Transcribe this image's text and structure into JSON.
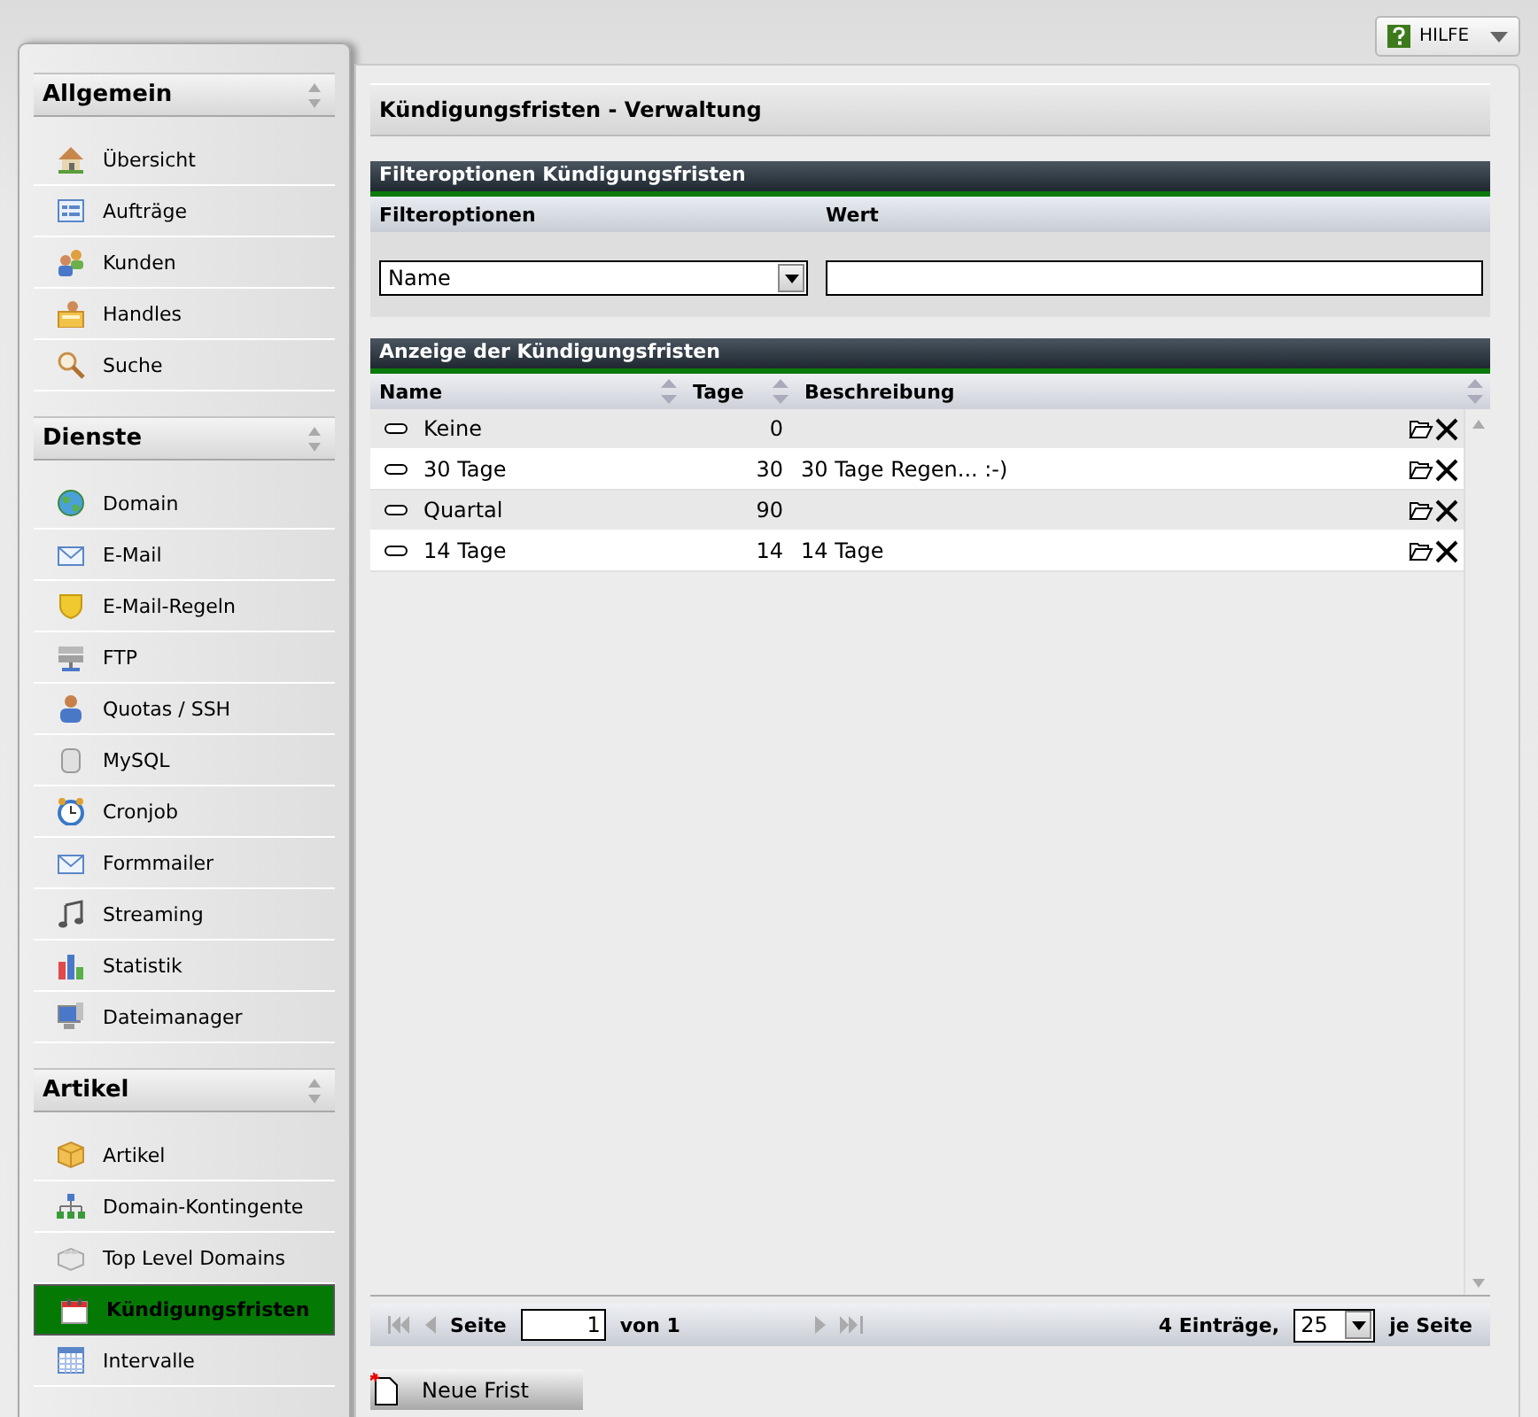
{
  "help_button": {
    "label": "HILFE"
  },
  "sidebar": {
    "sections": [
      {
        "title": "Allgemein",
        "items": [
          {
            "label": "Übersicht",
            "kind": "house",
            "selected": false
          },
          {
            "label": "Aufträge",
            "kind": "list",
            "selected": false
          },
          {
            "label": "Kunden",
            "kind": "users",
            "selected": false
          },
          {
            "label": "Handles",
            "kind": "userfolder",
            "selected": false
          },
          {
            "label": "Suche",
            "kind": "search",
            "selected": false
          }
        ]
      },
      {
        "title": "Dienste",
        "items": [
          {
            "label": "Domain",
            "kind": "globe",
            "selected": false
          },
          {
            "label": "E-Mail",
            "kind": "mailopen",
            "selected": false
          },
          {
            "label": "E-Mail-Regeln",
            "kind": "shield",
            "selected": false
          },
          {
            "label": "FTP",
            "kind": "server",
            "selected": false
          },
          {
            "label": "Quotas / SSH",
            "kind": "user",
            "selected": false
          },
          {
            "label": "MySQL",
            "kind": "database",
            "selected": false
          },
          {
            "label": "Cronjob",
            "kind": "clock",
            "selected": false
          },
          {
            "label": "Formmailer",
            "kind": "mail",
            "selected": false
          },
          {
            "label": "Streaming",
            "kind": "music",
            "selected": false
          },
          {
            "label": "Statistik",
            "kind": "chart",
            "selected": false
          },
          {
            "label": "Dateimanager",
            "kind": "monitor",
            "selected": false
          }
        ]
      },
      {
        "title": "Artikel",
        "items": [
          {
            "label": "Artikel",
            "kind": "box",
            "selected": false
          },
          {
            "label": "Domain-Kontingente",
            "kind": "tree",
            "selected": false
          },
          {
            "label": "Top Level Domains",
            "kind": "bricks",
            "selected": false
          },
          {
            "label": "Kündigungsfristen",
            "kind": "calendar",
            "selected": true
          },
          {
            "label": "Intervalle",
            "kind": "grid",
            "selected": false
          }
        ]
      }
    ]
  },
  "page_title": "Kündigungsfristen - Verwaltung",
  "filter": {
    "title": "Filteroptionen Kündigungsfristen",
    "columns": [
      "Filteroptionen",
      "Wert"
    ],
    "option": "Name"
  },
  "table": {
    "title": "Anzeige der Kündigungsfristen",
    "columns": [
      "Name",
      "Tage",
      "Beschreibung"
    ],
    "rows": [
      {
        "name": "Keine",
        "tage": "0",
        "beschreibung": ""
      },
      {
        "name": "30 Tage",
        "tage": "30",
        "beschreibung": "30 Tage Regen... :-)"
      },
      {
        "name": "Quartal",
        "tage": "90",
        "beschreibung": ""
      },
      {
        "name": "14 Tage",
        "tage": "14",
        "beschreibung": "14 Tage"
      }
    ]
  },
  "pager": {
    "page_label": "Seite",
    "page": "1",
    "of": "von 1",
    "count": "4 Einträge,",
    "per_page": "25",
    "per_page_label": "je Seite"
  },
  "new_button": {
    "label": "Neue Frist"
  }
}
